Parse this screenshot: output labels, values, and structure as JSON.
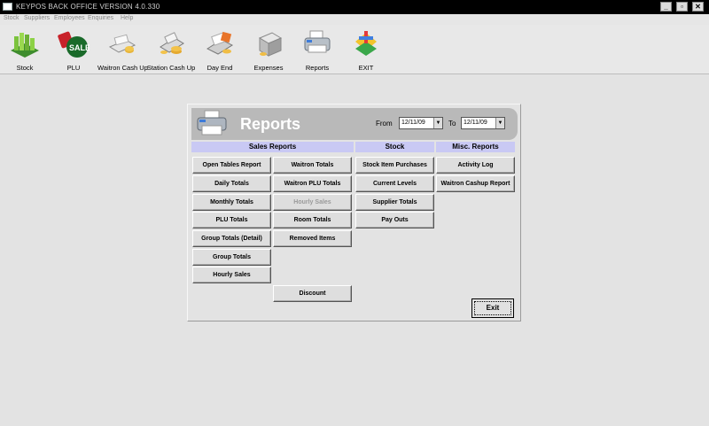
{
  "window": {
    "title": "KEYPOS BACK OFFICE VERSION 4.0.330",
    "minimize_label": "_",
    "restore_label": "▫",
    "close_label": "✕"
  },
  "menu": [
    "Stock",
    "Suppliers",
    "Employees",
    "Enquiries",
    "Help"
  ],
  "toolbar": [
    {
      "label": "Stock",
      "icon": "stock-icon"
    },
    {
      "label": "PLU",
      "icon": "plu-sale-icon"
    },
    {
      "label": "Waitron Cash Up",
      "icon": "waitron-cashup-icon"
    },
    {
      "label": "Station Cash Up",
      "icon": "station-cashup-icon"
    },
    {
      "label": "Day End",
      "icon": "day-end-icon"
    },
    {
      "label": "Expenses",
      "icon": "expenses-icon"
    },
    {
      "label": "Reports",
      "icon": "printer-icon"
    },
    {
      "label": "EXIT",
      "icon": "exit-icon"
    }
  ],
  "reports": {
    "title": "Reports",
    "from_label": "From",
    "from_date": "12/11/09",
    "to_label": "To",
    "to_date": "12/11/09",
    "sections": {
      "sales": "Sales Reports",
      "stock": "Stock",
      "misc": "Misc. Reports"
    },
    "sales_col1": [
      "Open Tables Report",
      "Daily Totals",
      "Monthly Totals",
      "PLU Totals",
      "Group Totals (Detail)",
      "Group Totals",
      "Hourly Sales"
    ],
    "sales_col2": [
      "Waitron Totals",
      "Waitron PLU Totals",
      "Hourly Sales",
      "Room Totals",
      "Removed Items"
    ],
    "sales_col2_disabled_index": 2,
    "discount": "Discount",
    "stock_items": [
      "Stock Item Purchases",
      "Current Levels",
      "Supplier Totals",
      "Pay Outs"
    ],
    "misc_items": [
      "Activity Log",
      "Waitron Cashup Report"
    ],
    "exit_label": "Exit"
  },
  "colors": {
    "section_header": "#c9c9f4",
    "panel_header": "#b9b9b9",
    "background": "#e3e3e3"
  }
}
